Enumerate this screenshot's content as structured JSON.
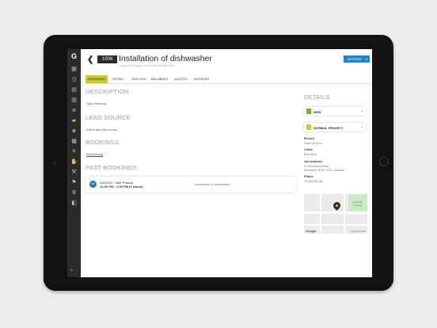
{
  "sidebar": {
    "logo": "G",
    "icons": [
      "calendar-icon",
      "clock-icon",
      "map-icon",
      "document-icon",
      "list-icon",
      "jobs-icon",
      "layers-icon",
      "building-icon",
      "tools-icon",
      "hand-icon",
      "wrench-icon",
      "tag-icon",
      "settings-icon",
      "toggle-icon"
    ],
    "active_index": 5,
    "collapse_glyph": "›"
  },
  "header": {
    "job_number": "1006",
    "title": "Installation of dishwasher",
    "subline": "Created by Maggie on Monday 3rd May 2019",
    "actions_label": "ACTIONS"
  },
  "tabs": [
    {
      "label": "OVERVIEW",
      "active": true
    },
    {
      "label": "NOTES",
      "active": false
    },
    {
      "label": "SITE LOG",
      "active": false
    },
    {
      "label": "BILLABLES",
      "active": false
    },
    {
      "label": "QUOTES",
      "active": false
    },
    {
      "label": "INVOICES",
      "active": false
    }
  ],
  "description": {
    "heading": "DESCRIPTION",
    "text": "Type Samsung"
  },
  "lead_source": {
    "heading": "LEAD SOURCE",
    "text": "Edit to add lead source"
  },
  "bookings": {
    "heading": "BOOKINGS",
    "link": "Add booking"
  },
  "past_bookings": {
    "heading": "PAST BOOKINGS",
    "items": [
      {
        "avatar": "MS",
        "line1": "2/8/2019 - Date Passed",
        "line2": "12:00 PM - 1:00 PM (1 Hours)",
        "description": "Installation of dishwasher"
      }
    ]
  },
  "details": {
    "heading": "DETAILS",
    "status": {
      "label": "NEW",
      "color": "#69b32d"
    },
    "priority": {
      "label": "NORMAL PRIORITY",
      "color": "#c7cc2d"
    },
    "recurs_label": "Recurs",
    "recurs_value": "Does not recur",
    "client_label": "Client",
    "client_value": "Bob Sethy",
    "address_label": "Job Address",
    "address_lines": [
      "87 Hornsbush Road",
      "Strathfield, NSW, 2135, Australia"
    ],
    "phone_label": "Phone",
    "phone_value": "+61423321234"
  },
  "map": {
    "google": "Google",
    "park_label": "Cardinal Freeman",
    "copyright": "Map data ©2019"
  },
  "colors": {
    "accent": "#c7cc2d",
    "primary": "#1f85c8",
    "rail": "#2b2b2b"
  }
}
